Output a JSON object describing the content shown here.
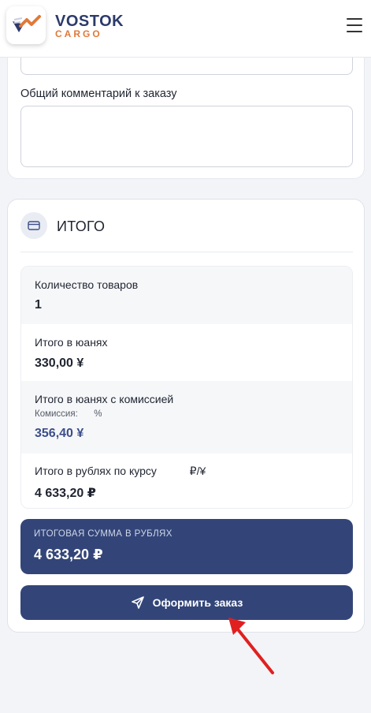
{
  "header": {
    "brand_name": "VOSTOK",
    "brand_sub": "CARGO",
    "logo_icon": "vostok-cargo-logo",
    "menu_icon": "hamburger-menu-icon"
  },
  "comment": {
    "label": "Общий комментарий к заказу",
    "value": ""
  },
  "totals": {
    "title": "ИТОГО",
    "icon": "credit-card-icon",
    "rows": [
      {
        "label": "Количество товаров",
        "value": "1"
      },
      {
        "label": "Итого в юанях",
        "value": "330,00 ¥"
      },
      {
        "label": "Итого в юанях с комиссией",
        "sub_prefix": "Комиссия:",
        "sub_suffix": "%",
        "value": "356,40 ¥"
      },
      {
        "label": "Итого в рублях по курсу",
        "rate_unit": "₽/¥",
        "value": "4 633,20 ₽"
      }
    ],
    "grand": {
      "label": "ИТОГОВАЯ СУММА В РУБЛЯХ",
      "value": "4 633,20 ₽"
    },
    "order_button": {
      "label": "Оформить заказ",
      "icon": "send-icon"
    }
  },
  "colors": {
    "primary": "#334578",
    "accent": "#e07a3a",
    "annotation_arrow": "#e02020"
  }
}
